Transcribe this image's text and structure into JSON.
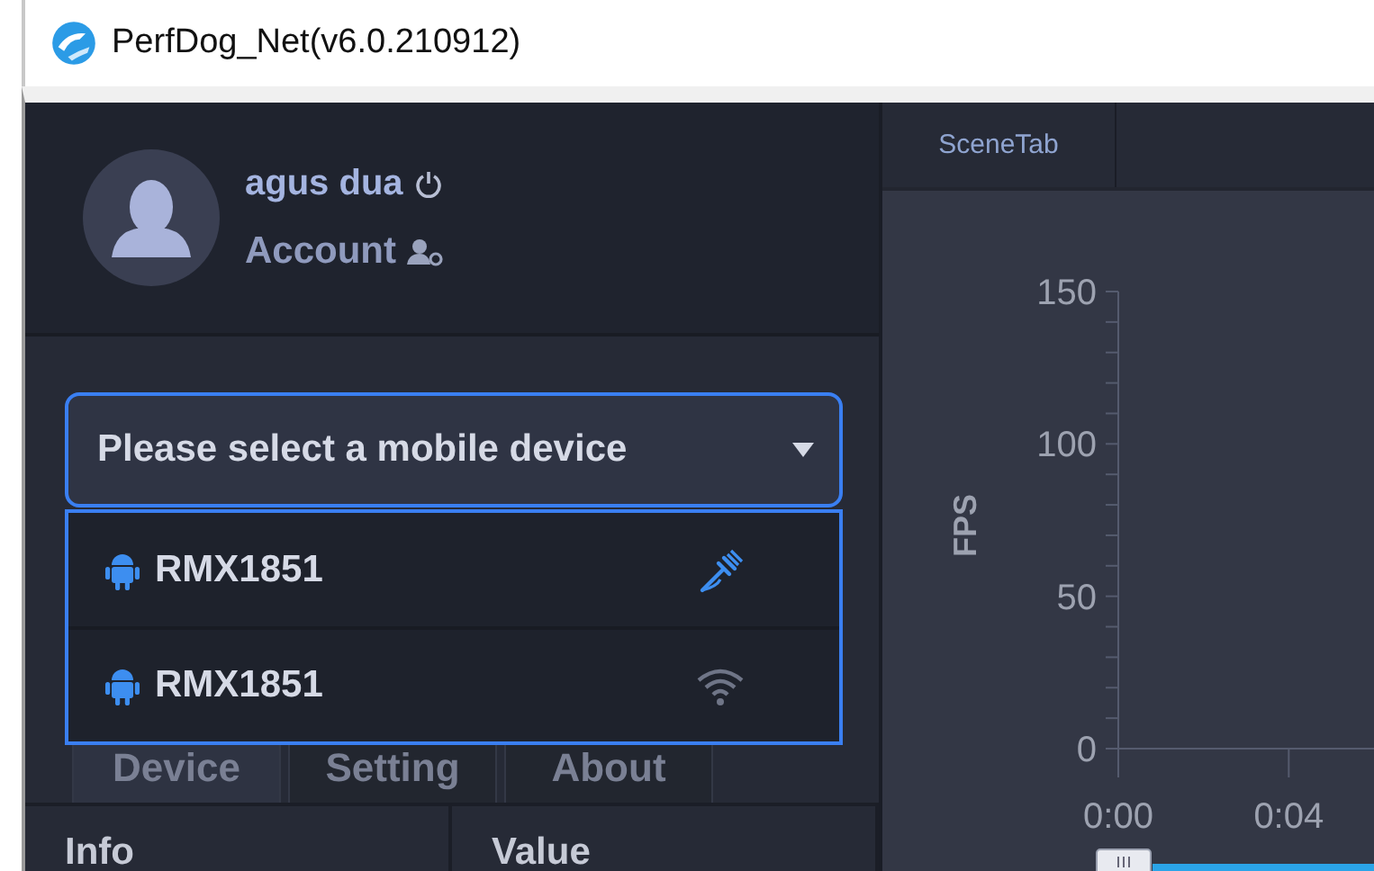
{
  "window": {
    "title": "PerfDog_Net(v6.0.210912)"
  },
  "user": {
    "name": "agus dua",
    "account_label": "Account"
  },
  "device_select": {
    "placeholder": "Please select a mobile device",
    "expanded": true,
    "devices": [
      {
        "name": "RMX1851",
        "kind": "usb"
      },
      {
        "name": "RMX1851",
        "kind": "wifi"
      }
    ]
  },
  "tabs": [
    {
      "label": "Device",
      "selected": true
    },
    {
      "label": "Setting",
      "selected": false
    },
    {
      "label": "About",
      "selected": false
    }
  ],
  "table": {
    "columns": [
      "Info",
      "Value"
    ]
  },
  "scene_tabs": [
    {
      "label": "SceneTab"
    }
  ],
  "chart_data": {
    "type": "line",
    "xlim": [
      0,
      6
    ],
    "ylabel": "FPS",
    "ylim": [
      0,
      150
    ],
    "yticks": [
      0,
      50,
      100,
      150
    ],
    "xticks": [
      {
        "value": 0,
        "label": "0:00"
      },
      {
        "value": 4,
        "label": "0:04"
      }
    ]
  }
}
